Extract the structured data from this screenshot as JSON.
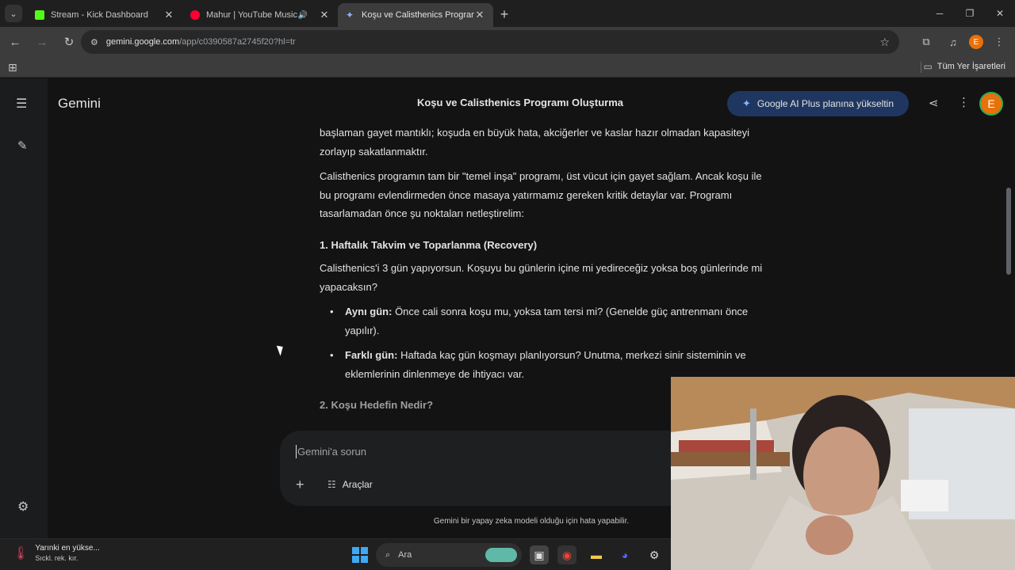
{
  "browser": {
    "tabs": [
      {
        "title": "Stream - Kick Dashboard",
        "favicon_color": "#53fc18"
      },
      {
        "title": "Mahur | YouTube Music",
        "favicon_color": "#ff0033"
      },
      {
        "title": "Koşu ve Calisthenics Programı C",
        "favicon_color": "#8ab4f8"
      }
    ],
    "url_host": "gemini.google.com",
    "url_path": "/app/c0390587a2745f20?hl=tr",
    "profile_initial": "E",
    "bookmarks_all": "Tüm Yer İşaretleri"
  },
  "gemini": {
    "brand": "Gemini",
    "chat_title": "Koşu ve Calisthenics Programı Oluşturma",
    "upgrade_label": "Google AI Plus planına yükseltin",
    "avatar_initial": "E",
    "response": {
      "p1": "başlaman gayet mantıklı; koşuda en büyük hata, akciğerler ve kaslar hazır olmadan kapasiteyi zorlayıp sakatlanmaktır.",
      "p2": "Calisthenics programın tam bir \"temel inşa\" programı, üst vücut için gayet sağlam. Ancak koşu ile bu programı evlendirmeden önce masaya yatırmamız gereken kritik detaylar var. Programı tasarlamadan önce şu noktaları netleştirelim:",
      "h1": "1. Haftalık Takvim ve Toparlanma (Recovery)",
      "p3": "Calisthenics'i 3 gün yapıyorsun. Koşuyu bu günlerin içine mi yedireceğiz yoksa boş günlerinde mi yapacaksın?",
      "bullets": [
        {
          "term": "Aynı gün:",
          "text": " Önce cali sonra koşu mu, yoksa tam tersi mi? (Genelde güç antrenmanı önce yapılır)."
        },
        {
          "term": "Farklı gün:",
          "text": " Haftada kaç gün koşmayı planlıyorsun? Unutma, merkezi sinir sisteminin ve eklemlerinin dinlenmeye de ihtiyacı var."
        }
      ],
      "h2": "2. Koşu Hedefin Nedir?"
    },
    "composer": {
      "placeholder": "Gemini'a sorun",
      "tools_label": "Araçlar"
    },
    "disclaimer": "Gemini bir yapay zeka modeli olduğu için hata yapabilir."
  },
  "taskbar": {
    "weather_line1": "Yarınki en yükse...",
    "weather_line2": "Sıckl. rek. kır.",
    "search_label": "Ara"
  }
}
